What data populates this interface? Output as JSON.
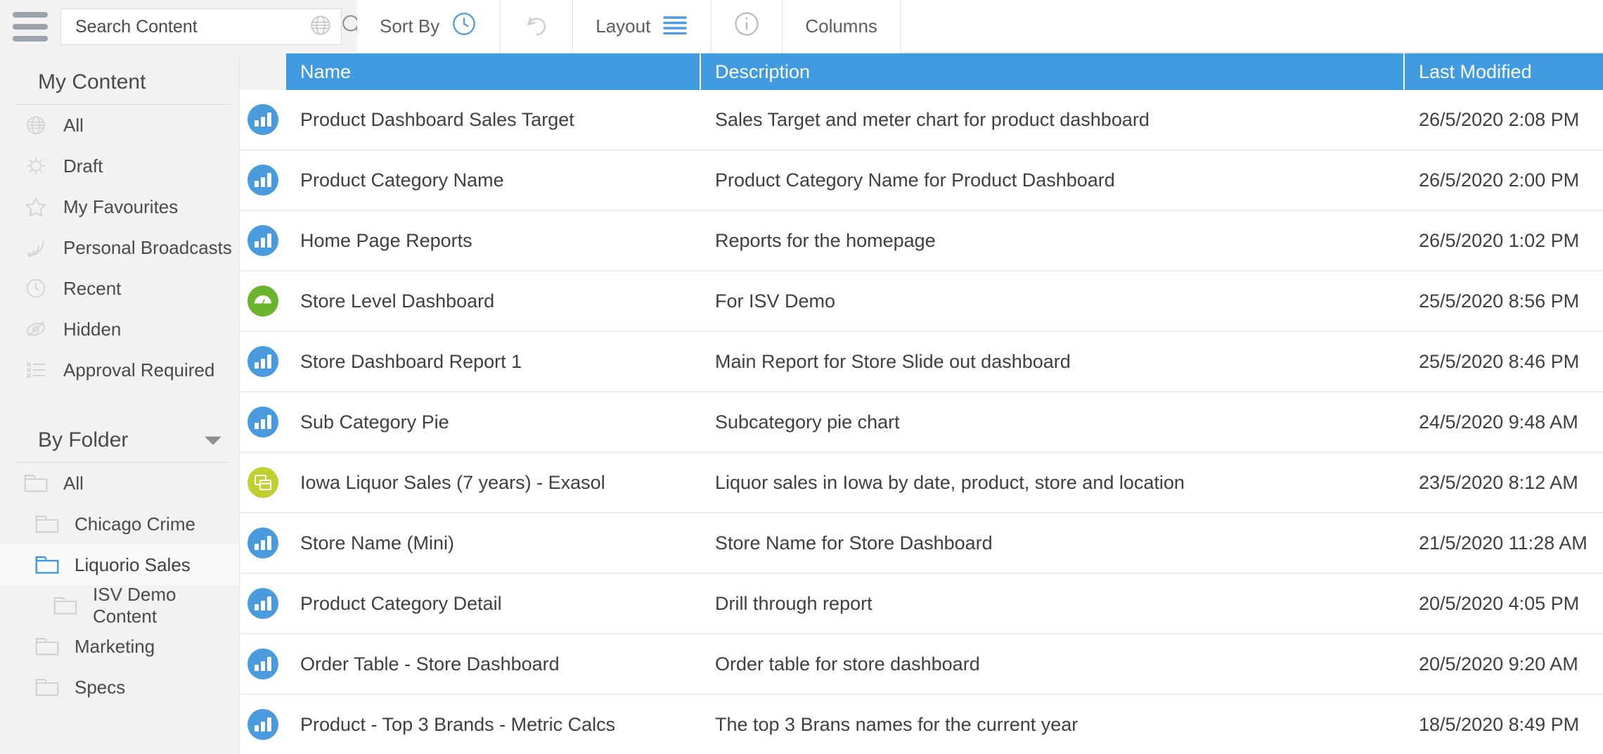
{
  "colors": {
    "header_blue": "#419be0",
    "icon_blue": "#4a9ade",
    "icon_green": "#6ab42e",
    "icon_lime": "#bfd130",
    "sidebar_bg": "#f2f2f2",
    "text": "#3f3f3f"
  },
  "topbar": {
    "menu_icon": "hamburger-icon",
    "search": {
      "placeholder": "Search Content",
      "value": "",
      "globe_icon": "globe-icon",
      "search_icon": "search-icon"
    },
    "toolbar_items": [
      {
        "label": "Sort By",
        "icon": "clock-icon",
        "active": true
      },
      {
        "label": "",
        "icon": "undo-icon",
        "active": false
      },
      {
        "label": "Layout",
        "icon": "list-lines-icon",
        "active": true
      },
      {
        "label": "",
        "icon": "info-icon",
        "active": false
      },
      {
        "label": "Columns",
        "icon": "",
        "active": false
      }
    ]
  },
  "sidebar": {
    "my_content": {
      "title": "My Content",
      "items": [
        {
          "label": "All",
          "icon": "globe-icon"
        },
        {
          "label": "Draft",
          "icon": "gear-icon"
        },
        {
          "label": "My Favourites",
          "icon": "star-icon"
        },
        {
          "label": "Personal Broadcasts",
          "icon": "rss-icon"
        },
        {
          "label": "Recent",
          "icon": "clock-icon"
        },
        {
          "label": "Hidden",
          "icon": "eye-slash-icon"
        },
        {
          "label": "Approval Required",
          "icon": "checklist-icon"
        }
      ]
    },
    "by_folder": {
      "title": "By Folder",
      "caret_icon": "chevron-down-icon",
      "items": [
        {
          "label": "All",
          "indent": 0,
          "selected": false
        },
        {
          "label": "Chicago Crime",
          "indent": 1,
          "selected": false
        },
        {
          "label": "Liquorio Sales",
          "indent": 1,
          "selected": true
        },
        {
          "label": "ISV Demo Content",
          "indent": 2,
          "selected": false
        },
        {
          "label": "Marketing",
          "indent": 1,
          "selected": false
        },
        {
          "label": "Specs",
          "indent": 1,
          "selected": false
        }
      ]
    }
  },
  "table": {
    "columns": [
      {
        "key": "name",
        "label": "Name"
      },
      {
        "key": "description",
        "label": "Description"
      },
      {
        "key": "modified",
        "label": "Last Modified"
      }
    ],
    "rows": [
      {
        "icon": "bar-chart-icon",
        "icon_color": "blue",
        "name": "Product Dashboard Sales Target",
        "description": "Sales Target and meter chart for product dashboard",
        "modified": "26/5/2020 2:08 PM"
      },
      {
        "icon": "bar-chart-icon",
        "icon_color": "blue",
        "name": "Product Category Name",
        "description": "Product Category Name for Product Dashboard",
        "modified": "26/5/2020 2:00 PM"
      },
      {
        "icon": "bar-chart-icon",
        "icon_color": "blue",
        "name": "Home Page Reports",
        "description": "Reports for the homepage",
        "modified": "26/5/2020 1:02 PM"
      },
      {
        "icon": "gauge-icon",
        "icon_color": "green",
        "name": "Store Level Dashboard",
        "description": "For ISV Demo",
        "modified": "25/5/2020 8:56 PM"
      },
      {
        "icon": "bar-chart-icon",
        "icon_color": "blue",
        "name": "Store Dashboard Report 1",
        "description": "Main Report for Store Slide out dashboard",
        "modified": "25/5/2020 8:46 PM"
      },
      {
        "icon": "bar-chart-icon",
        "icon_color": "blue",
        "name": "Sub Category Pie",
        "description": "Subcategory pie chart",
        "modified": "24/5/2020 9:48 AM"
      },
      {
        "icon": "panels-icon",
        "icon_color": "lime",
        "name": "Iowa Liquor Sales (7 years) - Exasol",
        "description": "Liquor sales in Iowa by date, product, store and location",
        "modified": "23/5/2020 8:12 AM"
      },
      {
        "icon": "bar-chart-icon",
        "icon_color": "blue",
        "name": "Store Name (Mini)",
        "description": "Store Name for Store Dashboard",
        "modified": "21/5/2020 11:28 AM"
      },
      {
        "icon": "bar-chart-icon",
        "icon_color": "blue",
        "name": "Product Category Detail",
        "description": "Drill through report",
        "modified": "20/5/2020 4:05 PM"
      },
      {
        "icon": "bar-chart-icon",
        "icon_color": "blue",
        "name": "Order Table - Store Dashboard",
        "description": "Order table for store dashboard",
        "modified": "20/5/2020 9:20 AM"
      },
      {
        "icon": "bar-chart-icon",
        "icon_color": "blue",
        "name": "Product - Top 3 Brands - Metric Calcs",
        "description": "The top 3 Brans names for the current year",
        "modified": "18/5/2020 8:49 PM"
      }
    ]
  }
}
